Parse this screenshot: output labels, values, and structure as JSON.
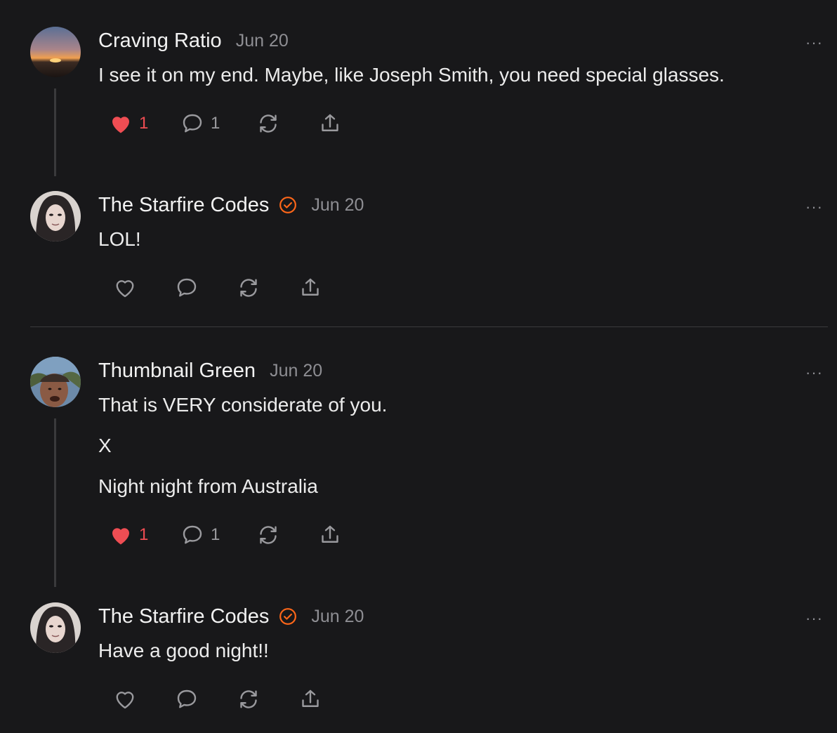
{
  "comments": [
    {
      "author": "Craving Ratio",
      "date": "Jun 20",
      "more": "···",
      "lines": [
        "I see it on my end. Maybe, like Joseph Smith, you need special glasses."
      ],
      "likes": "1",
      "replies": "1",
      "liked": true,
      "verified": false
    },
    {
      "author": "The Starfire Codes",
      "date": "Jun 20",
      "more": "···",
      "lines": [
        "LOL!"
      ],
      "liked": false,
      "verified": true
    },
    {
      "author": "Thumbnail Green",
      "date": "Jun 20",
      "more": "···",
      "lines": [
        "That is VERY considerate of you.",
        "X",
        "Night night from Australia"
      ],
      "likes": "1",
      "replies": "1",
      "liked": true,
      "verified": false
    },
    {
      "author": "The Starfire Codes",
      "date": "Jun 20",
      "more": "···",
      "lines": [
        "Have a good night!!"
      ],
      "liked": false,
      "verified": true
    }
  ],
  "colors": {
    "background": "#18181a",
    "like_red": "#ef4d53",
    "verified_orange": "#ff6719",
    "muted": "#8e8e93"
  },
  "icons": [
    "heart-icon",
    "comment-icon",
    "restack-icon",
    "share-icon",
    "verified-icon",
    "more-icon"
  ]
}
